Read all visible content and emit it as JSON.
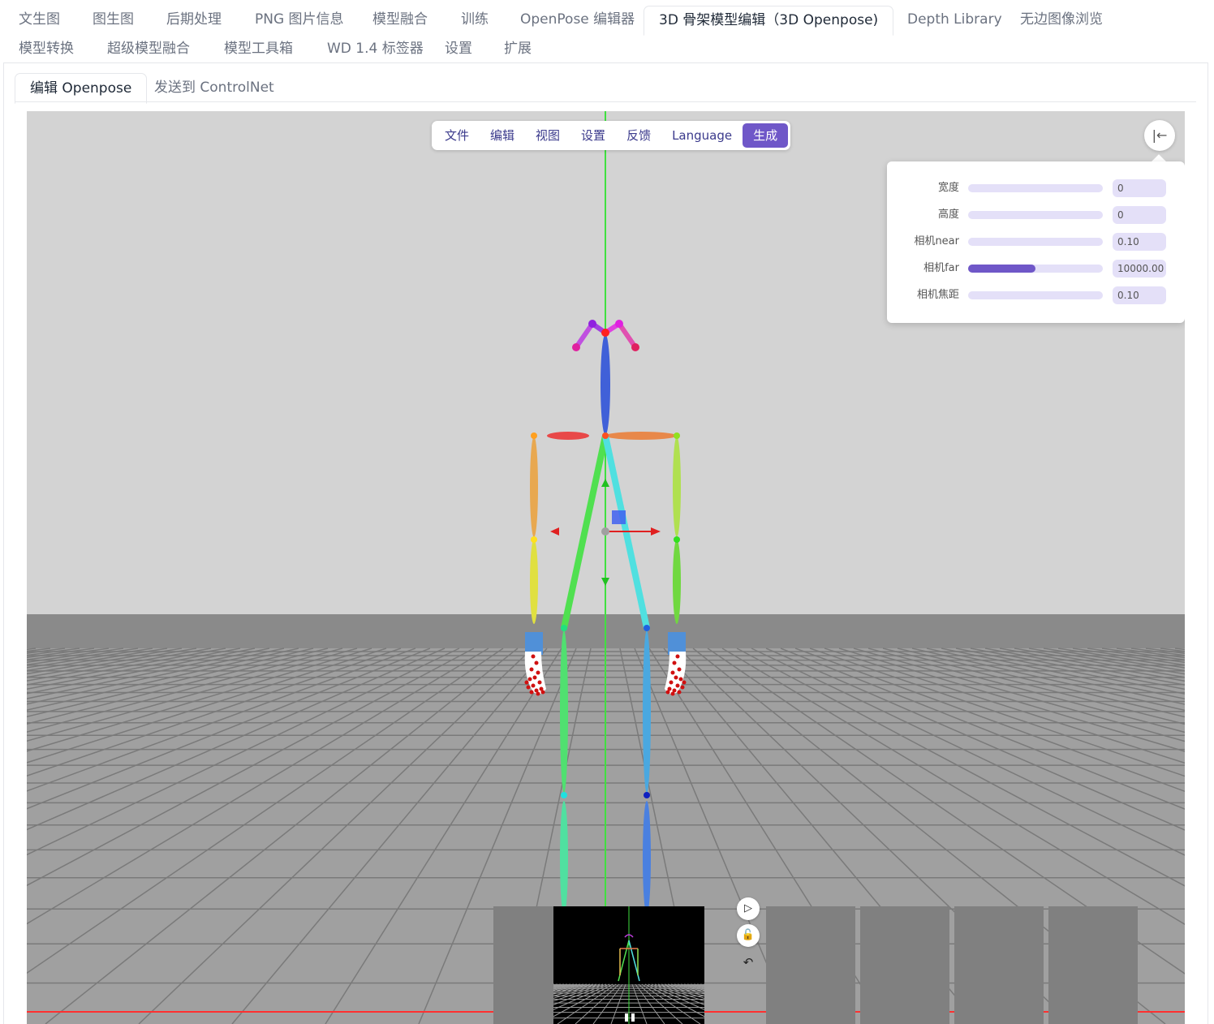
{
  "main_tabs": [
    {
      "label": "文生图"
    },
    {
      "label": "图生图"
    },
    {
      "label": "后期处理"
    },
    {
      "label": "PNG 图片信息"
    },
    {
      "label": "模型融合"
    },
    {
      "label": "训练"
    },
    {
      "label": "OpenPose 编辑器"
    },
    {
      "label": "3D 骨架模型编辑（3D Openpose)"
    },
    {
      "label": "Depth Library"
    },
    {
      "label": "无边图像浏览"
    },
    {
      "label": "模型转换"
    },
    {
      "label": "超级模型融合"
    },
    {
      "label": "模型工具箱"
    },
    {
      "label": "WD 1.4 标签器"
    },
    {
      "label": "设置"
    },
    {
      "label": "扩展"
    }
  ],
  "active_main_tab": "3D 骨架模型编辑（3D Openpose)",
  "sub_tabs": [
    {
      "label": "编辑 Openpose"
    },
    {
      "label": "发送到 ControlNet"
    }
  ],
  "menu": {
    "items": [
      {
        "label": "文件"
      },
      {
        "label": "编辑"
      },
      {
        "label": "视图"
      },
      {
        "label": "设置"
      },
      {
        "label": "反馈"
      },
      {
        "label": "Language"
      }
    ],
    "generate_label": "生成"
  },
  "collapse_icon": "collapse-left-icon",
  "camera_panel": {
    "rows": [
      {
        "label": "宽度",
        "value": "0",
        "fill": 0
      },
      {
        "label": "高度",
        "value": "0",
        "fill": 0
      },
      {
        "label": "相机near",
        "value": "0.10",
        "fill": 0
      },
      {
        "label": "相机far",
        "value": "10000.00",
        "fill": 0.5
      },
      {
        "label": "相机焦距",
        "value": "0.10",
        "fill": 0
      }
    ]
  },
  "preview_tools": {
    "icons": [
      "play-next-icon",
      "unlock-icon",
      "undo-icon"
    ]
  },
  "colors": {
    "accent": "#6f57c8",
    "accent_light": "#e4e0f8",
    "viewport_bg": "#d3d3d3",
    "floor": "#a0a0a0",
    "grid": "#7a7a7a"
  }
}
